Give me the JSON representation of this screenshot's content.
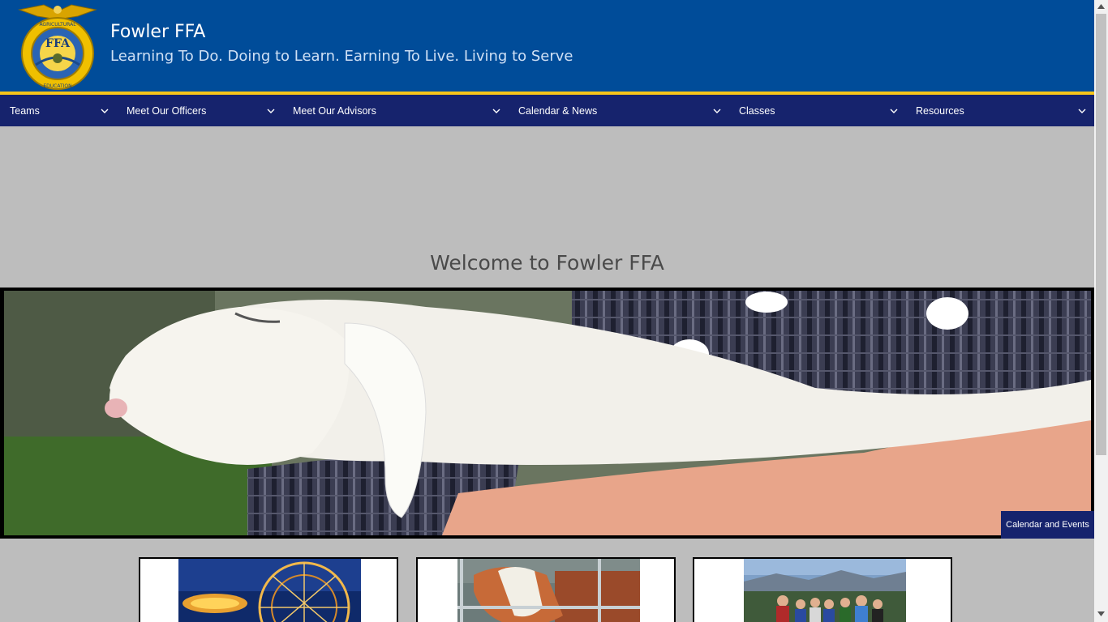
{
  "header": {
    "title": "Fowler FFA",
    "tagline": "Learning To Do. Doing to Learn. Earning To Live. Living to Serve",
    "logo_icon": "ffa-emblem-icon",
    "logo_text": "FFA",
    "logo_ring_text": "AGRICULTURAL EDUCATION"
  },
  "nav": {
    "items": [
      {
        "label": "Teams"
      },
      {
        "label": "Meet Our Officers"
      },
      {
        "label": "Meet Our Advisors"
      },
      {
        "label": "Calendar & News"
      },
      {
        "label": "Classes"
      },
      {
        "label": "Resources"
      }
    ],
    "chevron_icon": "chevron-down-icon"
  },
  "main": {
    "welcome": "Welcome to Fowler FFA",
    "calendar_button": "Calendar and Events"
  },
  "colors": {
    "header_bg": "#004c99",
    "nav_bg": "#16236d",
    "stripe": "#f6c41b",
    "page_bg": "#bdbdbd"
  }
}
